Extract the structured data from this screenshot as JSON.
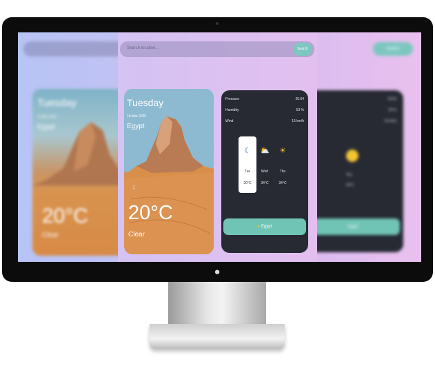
{
  "search": {
    "placeholder": "Search location...",
    "button": "Search"
  },
  "weather": {
    "day": "Tuesday",
    "date": "10 Mar 2025",
    "city": "Egypt",
    "temperature": "20°C",
    "condition": "Clear"
  },
  "details": [
    {
      "label": "Pressure",
      "value": "20.04"
    },
    {
      "label": "Humidity",
      "value": "53 %"
    },
    {
      "label": "Wind",
      "value": "15 km/h"
    }
  ],
  "forecast": [
    {
      "day": "Tue",
      "temp": "20°C",
      "icon": "moon-icon",
      "active": true
    },
    {
      "day": "Wed",
      "temp": "34°C",
      "icon": "sun-cloud-icon",
      "active": false
    },
    {
      "day": "Thu",
      "temp": "34°C",
      "icon": "sun-icon",
      "active": false
    }
  ],
  "location_button": "Egypt",
  "colors": {
    "accent": "#70c4b5",
    "card": "#272a33"
  }
}
